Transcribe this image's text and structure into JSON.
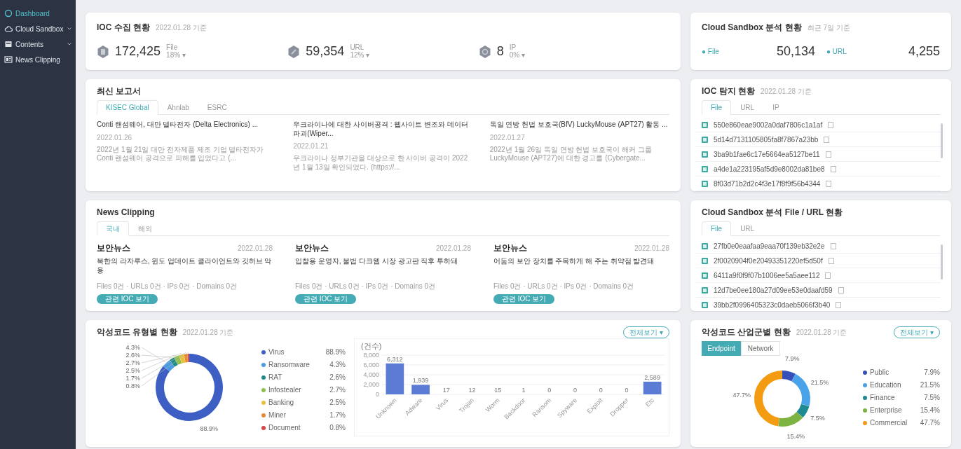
{
  "sidebar": {
    "items": [
      {
        "label": "Dashboard",
        "selected": true,
        "expandable": false
      },
      {
        "label": "Cloud Sandbox",
        "selected": false,
        "expandable": true
      },
      {
        "label": "Contents",
        "selected": false,
        "expandable": true
      },
      {
        "label": "News Clipping",
        "selected": false,
        "expandable": false
      }
    ]
  },
  "ioc_collection": {
    "title": "IOC 수집 현황",
    "date": "2022.01.28 기준",
    "stats": [
      {
        "value": "172,425",
        "label": "File",
        "change": "18% ▾"
      },
      {
        "value": "59,354",
        "label": "URL",
        "change": "12% ▾"
      },
      {
        "value": "8",
        "label": "IP",
        "change": "0% ▾"
      }
    ]
  },
  "sandbox_summary": {
    "title": "Cloud Sandbox 분석 현황",
    "date": "최근 7일 기준",
    "stats": [
      {
        "label": "● File",
        "value": "50,134"
      },
      {
        "label": "● URL",
        "value": "4,255"
      }
    ]
  },
  "reports": {
    "title": "최신 보고서",
    "tabs": [
      {
        "label": "KISEC Global",
        "selected": true
      },
      {
        "label": "Ahnlab",
        "selected": false
      },
      {
        "label": "ESRC",
        "selected": false
      }
    ],
    "items": [
      {
        "title": "Conti 랜섬웨어, 대만 델타전자 (Delta Electronics) ...",
        "date": "2022.01.26",
        "body": "2022년 1월 21일 대만 전자제품 제조 기업 델타전자가 Conti 랜섬웨어 공격으로 피해를 입었다고 (..."
      },
      {
        "title": "우크라이나에 대한 사이버공격 : 웹사이트 변조와 데이터 파괴(Wiper...",
        "date": "2022.01.21",
        "body": "우크라이나 정부기관을 대상으로 한 사이버 공격이 2022년 1월 13일 확인되었다. (https://..."
      },
      {
        "title": "독일 연방 헌법 보호국(BfV) LuckyMouse (APT27) 활동 ...",
        "date": "2022.01.27",
        "body": "2022년 1월 26일 독일 연방 헌법 보호국이 해커 그룹 LuckyMouse (APT27)에 대한 경고를 (Cybergate..."
      }
    ]
  },
  "news": {
    "title": "News Clipping",
    "tabs": [
      {
        "label": "국내",
        "selected": true
      },
      {
        "label": "해외",
        "selected": false
      }
    ],
    "items": [
      {
        "source": "보안뉴스",
        "date": "2022.01.28",
        "headline": "북한의 라자루스, 윈도 업데이트 클라이언트와 깃허브 악용",
        "meta": "Files 0건 · URLs 0건 · IPs 0건 · Domains 0건",
        "button": "관련 IOC 보기"
      },
      {
        "source": "보안뉴스",
        "date": "2022.01.28",
        "headline": "입찰용 운영자, 불법 다크웹 시장 광고판 직후 투하돼",
        "meta": "Files 0건 · URLs 0건 · IPs 0건 · Domains 0건",
        "button": "관련 IOC 보기"
      },
      {
        "source": "보안뉴스",
        "date": "2022.01.28",
        "headline": "어둠의 보안 장치를 주목하게 해 주는 취약점 발견돼",
        "meta": "Files 0건 · URLs 0건 · IPs 0건 · Domains 0건",
        "button": "관련 IOC 보기"
      }
    ]
  },
  "ioc_detection": {
    "title": "IOC 탐지 현황",
    "date": "2022.01.28 기준",
    "tabs": [
      {
        "label": "File",
        "selected": true
      },
      {
        "label": "URL",
        "selected": false
      },
      {
        "label": "IP",
        "selected": false
      }
    ],
    "rows": [
      "550e860eae9002a0daf7806c1a1af",
      "5d14d7131105805fa8f7867a23bb",
      "3ba9b1fae6c17e5664ea5127be11",
      "a4de1a223195af5d9e8002da81be8",
      "8f03d71b2d2c4f3e17f8f9f56b4344"
    ]
  },
  "sandbox_files": {
    "title": "Cloud Sandbox 분석 File / URL 현황",
    "tabs": [
      {
        "label": "File",
        "selected": true
      },
      {
        "label": "URL",
        "selected": false
      }
    ],
    "rows": [
      "27fb0e0eaafaa9eaa70f139eb32e2e",
      "2f0020904f0e20493351220ef5d50f",
      "6411a9f0f9f07b1006ee5a5aee112",
      "12d7be0ee180a27d09ee53e0daafd59",
      "39bb2f0996405323c0daeb5066f3b40"
    ]
  },
  "malware_types": {
    "title": "악성코드 유형별 현황",
    "date": "2022.01.28 기준",
    "button": "전체보기 ▾",
    "legend": [
      {
        "value": "88.9%",
        "color": "#3d5fc4"
      },
      {
        "value": "4.3%",
        "color": "#4a9be0"
      },
      {
        "value": "2.6%",
        "color": "#1f8a8a"
      },
      {
        "value": "2.7%",
        "color": "#8fbf4a"
      },
      {
        "value": "2.5%",
        "color": "#e8c23a"
      },
      {
        "value": "1.7%",
        "color": "#e88a3a"
      },
      {
        "value": "0.8%",
        "color": "#d64545"
      }
    ],
    "chart_data": {
      "type": "donut",
      "categories": [
        "Virus",
        "Ransomware",
        "RAT",
        "Infostealer",
        "Banking",
        "Miner",
        "Document"
      ],
      "values": [
        88.9,
        4.3,
        2.6,
        2.7,
        2.5,
        1.7,
        0.8
      ],
      "value_labels": [
        "88.9%",
        "4.3%",
        "2.6%",
        "2.7%",
        "2.5%",
        "1.7%",
        "0.8%"
      ]
    },
    "bar_chart": {
      "chart_data": {
        "type": "bar",
        "ylabel": "(건수)",
        "categories": [
          "Unknown",
          "Adware",
          "Virus",
          "Trojan",
          "Worm",
          "Backdoor",
          "Ransom",
          "Spyware",
          "Exploit",
          "Dropper",
          "Etc"
        ],
        "series": [
          {
            "color": "#5b7bd5",
            "values": [
              6312,
              1939,
              17,
              12,
              15,
              1,
              0,
              0,
              0,
              0,
              2589
            ]
          }
        ],
        "value_labels": [
          "6,312",
          "1,939",
          "17",
          "12",
          "15",
          "1",
          "0",
          "0",
          "0",
          "0",
          "2,589"
        ],
        "ylim": [
          0,
          8000
        ],
        "yticks": [
          {
            "value": 0,
            "label": "0"
          },
          {
            "value": 2000,
            "label": "2,000"
          },
          {
            "value": 4000,
            "label": "4,000"
          },
          {
            "value": 6000,
            "label": "6,000"
          },
          {
            "value": 8000,
            "label": "8,000"
          }
        ],
        "grid": true
      }
    }
  },
  "industry": {
    "title": "악성코드 산업군별 현황",
    "date": "2022.01.28 기준",
    "button": "전체보기 ▾",
    "tabs": [
      {
        "label": "Endpoint",
        "selected": true
      },
      {
        "label": "Network",
        "selected": false
      }
    ],
    "legend": [
      {
        "value": "7.9%",
        "color": "#3550b8"
      },
      {
        "value": "21.5%",
        "color": "#4aa3e8"
      },
      {
        "value": "7.5%",
        "color": "#1d8a94"
      },
      {
        "value": "15.4%",
        "color": "#7cb342"
      },
      {
        "value": "47.7%",
        "color": "#f39c12"
      }
    ],
    "chart_data": {
      "type": "donut",
      "categories": [
        "Public",
        "Education",
        "Finance",
        "Enterprise",
        "Commercial"
      ],
      "values": [
        7.9,
        21.5,
        7.5,
        15.4,
        47.7
      ],
      "value_labels": [
        "7.9%",
        "21.5%",
        "7.5%",
        "15.4%",
        "47.7%"
      ]
    }
  }
}
